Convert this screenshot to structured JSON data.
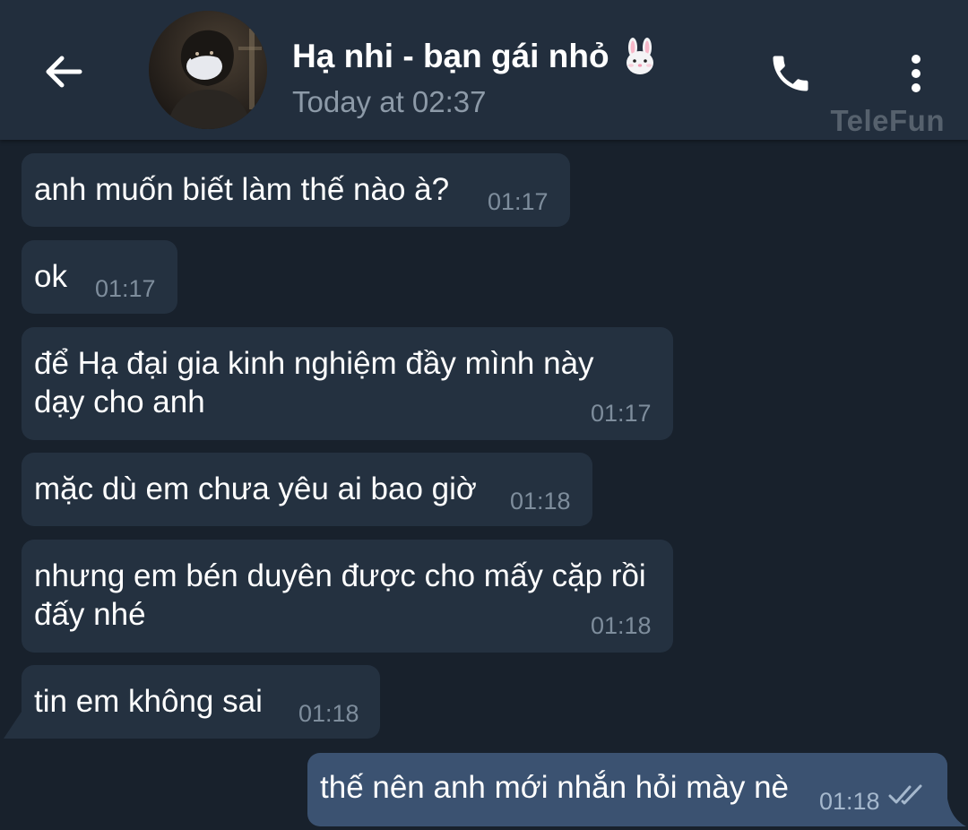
{
  "header": {
    "back_icon": "arrow-left-icon",
    "title": "Hạ nhi - bạn gái nhỏ",
    "title_emoji": "rabbit-face-icon",
    "last_seen": "Today at 02:37",
    "call_icon": "phone-icon",
    "menu_icon": "more-vertical-icon",
    "watermark": "TeleFun"
  },
  "messages": [
    {
      "direction": "incoming",
      "text": "anh muốn biết làm thế nào à?",
      "time": "01:17"
    },
    {
      "direction": "incoming",
      "text": "ok",
      "time": "01:17"
    },
    {
      "direction": "incoming",
      "text_lines": [
        "để Hạ đại gia kinh nghiệm đầy mình này",
        "dạy cho anh"
      ],
      "time": "01:17"
    },
    {
      "direction": "incoming",
      "text": "mặc dù em chưa yêu ai bao giờ",
      "time": "01:18"
    },
    {
      "direction": "incoming",
      "text_lines": [
        "nhưng em bén duyên được cho mấy cặp rồi",
        "đấy nhé"
      ],
      "time": "01:18"
    },
    {
      "direction": "incoming",
      "text": "tin em không sai",
      "time": "01:18"
    },
    {
      "direction": "outgoing",
      "text": "thế nên anh mới nhắn hỏi mày nè",
      "time": "01:18",
      "status_icon": "double-check-icon"
    }
  ],
  "colors": {
    "background": "#18212c",
    "header": "#222e3d",
    "incoming_bubble": "#243140",
    "outgoing_bubble": "#3b5271",
    "timestamp": "#7e8d9c"
  }
}
